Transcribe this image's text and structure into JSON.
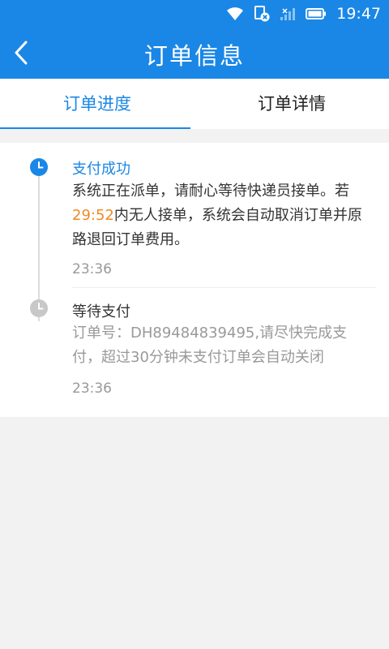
{
  "status_bar": {
    "time": "19:47",
    "icons": [
      "wifi-icon",
      "sim-disabled-icon",
      "signal-icon",
      "battery-icon"
    ]
  },
  "header": {
    "title": "订单信息",
    "back_icon": "chevron-left-icon"
  },
  "tabs": [
    {
      "label": "订单进度",
      "active": true
    },
    {
      "label": "订单详情",
      "active": false
    }
  ],
  "timeline": [
    {
      "title": "支付成功",
      "body_prefix": "系统正在派单，请耐心等待快递员接单。若",
      "countdown": "29:52",
      "body_suffix": "内无人接单，系统会自动取消订单并原路退回订单费用。",
      "time": "23:36",
      "icon": "clock-icon",
      "state": "active"
    },
    {
      "title": "等待支付",
      "body": "订单号：DH89484839495,请尽快完成支付，超过30分钟未支付订单会自动关闭",
      "time": "23:36",
      "icon": "clock-icon",
      "state": "inactive"
    }
  ],
  "colors": {
    "primary": "#1a87e6",
    "highlight": "#f08a24",
    "muted": "#999999",
    "inactive_icon": "#c8c8c8",
    "background": "#f2f2f2"
  }
}
